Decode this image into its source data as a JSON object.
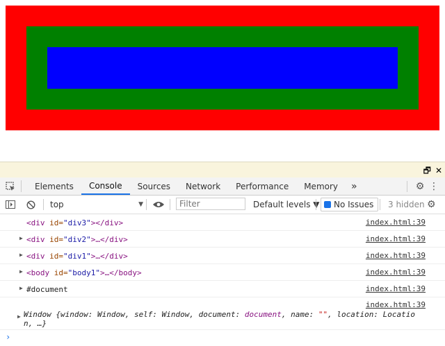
{
  "page": {
    "colors": {
      "div3": "#ff0000",
      "div2": "#008000",
      "div1": "#0000ff"
    }
  },
  "devtools": {
    "dock_icons": [
      "undock-icon",
      "close-icon"
    ],
    "tabs": [
      "Elements",
      "Console",
      "Sources",
      "Network",
      "Performance",
      "Memory"
    ],
    "active_tab": "Console",
    "more_tabs": "»",
    "toolbar": {
      "context": "top",
      "filter_placeholder": "Filter",
      "levels": "Default levels ▼",
      "issues": "No Issues",
      "hidden": "3 hidden"
    },
    "console_rows": [
      {
        "open": "<div",
        "attr": " id=",
        "val": "\"div3\"",
        "close": "></div>",
        "link": "index.html:39"
      },
      {
        "open": "<div",
        "attr": " id=",
        "val": "\"div2\"",
        "close": ">…</div>",
        "link": "index.html:39"
      },
      {
        "open": "<div",
        "attr": " id=",
        "val": "\"div1\"",
        "close": ">…</div>",
        "link": "index.html:39"
      },
      {
        "open": "<body",
        "attr": " id=",
        "val": "\"body1\"",
        "close": ">…</body>",
        "link": "index.html:39"
      },
      {
        "text": "#document",
        "link": "index.html:39"
      }
    ],
    "window_row": {
      "link": "index.html:39",
      "p1": "Window {window: Window, self: Window, document: ",
      "doc": "document",
      "p2": ", name: ",
      "str": "\"\"",
      "p3": ", location: Locatio n, …}"
    },
    "prompt": "›"
  }
}
